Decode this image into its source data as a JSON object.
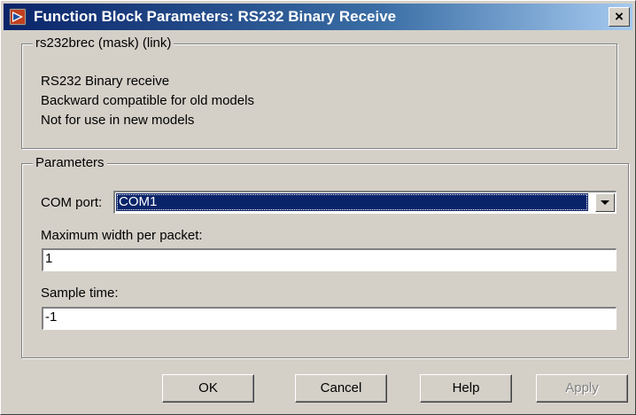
{
  "window": {
    "title": "Function Block Parameters: RS232 Binary Receive",
    "close_glyph": "×"
  },
  "description": {
    "group_label": "rs232brec (mask) (link)",
    "lines": [
      "RS232 Binary receive",
      "Backward compatible for old models",
      "Not for use in new models"
    ]
  },
  "parameters": {
    "group_label": "Parameters",
    "com_port": {
      "label": "COM port:",
      "value": "COM1"
    },
    "max_width": {
      "label": "Maximum width per packet:",
      "value": "1"
    },
    "sample_time": {
      "label": "Sample time:",
      "value": "-1"
    }
  },
  "buttons": {
    "ok": "OK",
    "cancel": "Cancel",
    "help": "Help",
    "apply": "Apply"
  },
  "colors": {
    "dialog_face": "#d4d0c8",
    "title_active": "#0a246a",
    "selection": "#0a246a"
  }
}
